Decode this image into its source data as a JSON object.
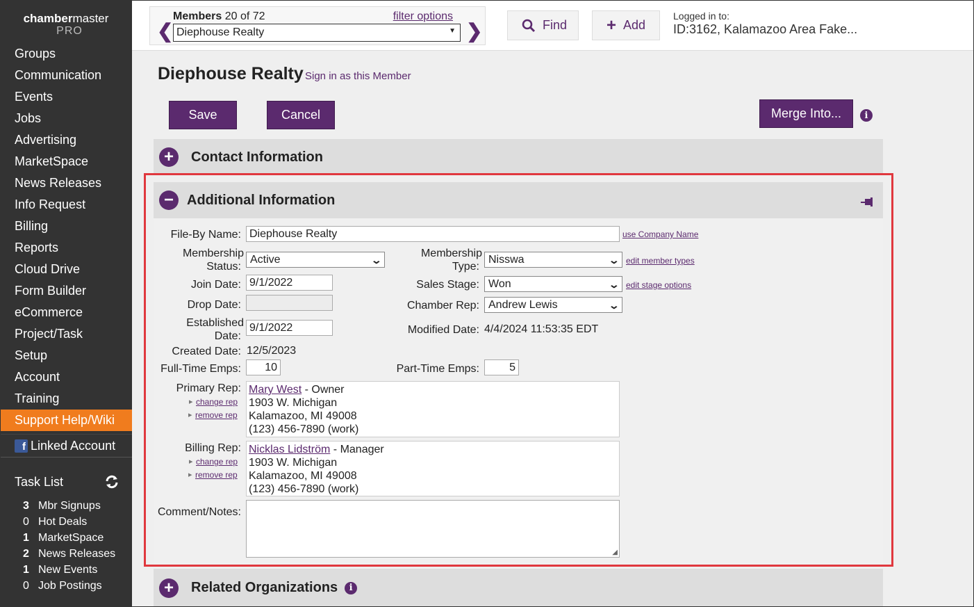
{
  "brand": {
    "line1_bold": "chamber",
    "line1_rest": "master",
    "line2": "PRO"
  },
  "sidebar": {
    "items": [
      "Groups",
      "Communication",
      "Events",
      "Jobs",
      "Advertising",
      "MarketSpace",
      "News Releases",
      "Info Request",
      "Billing",
      "Reports",
      "Cloud Drive",
      "Form Builder",
      "eCommerce",
      "Project/Task",
      "Setup",
      "Account",
      "Training",
      "Support Help/Wiki"
    ],
    "linked_account": "Linked Account",
    "task_list_title": "Task List",
    "tasks": [
      {
        "count": "3",
        "label": "Mbr Signups"
      },
      {
        "count": "0",
        "label": "Hot Deals"
      },
      {
        "count": "1",
        "label": "MarketSpace"
      },
      {
        "count": "2",
        "label": "News Releases"
      },
      {
        "count": "1",
        "label": "New Events"
      },
      {
        "count": "0",
        "label": "Job Postings"
      }
    ]
  },
  "topbar": {
    "members_label": "Members",
    "members_count": "20 of 72",
    "filter_options": "filter options",
    "member_select": "Diephouse Realty",
    "find": "Find",
    "add": "Add",
    "logged_label": "Logged in to:",
    "logged_value": "ID:3162, Kalamazoo Area Fake..."
  },
  "page": {
    "title": "Diephouse Realty",
    "sign_in": "Sign in as this Member",
    "save": "Save",
    "cancel": "Cancel",
    "merge": "Merge Into..."
  },
  "sections": {
    "contact": "Contact Information",
    "additional": "Additional Information",
    "related": "Related Organizations"
  },
  "form": {
    "file_by_label": "File-By Name:",
    "file_by_value": "Diephouse Realty",
    "use_company_name": "use Company Name",
    "membership_status_label1": "Membership",
    "membership_status_label2": "Status:",
    "membership_status_value": "Active",
    "membership_type_label1": "Membership",
    "membership_type_label2": "Type:",
    "membership_type_value": "Nisswa",
    "edit_member_types": "edit member types",
    "join_date_label": "Join Date:",
    "join_date_value": "9/1/2022",
    "sales_stage_label": "Sales Stage:",
    "sales_stage_value": "Won",
    "edit_stage_options": "edit stage options",
    "drop_date_label": "Drop Date:",
    "chamber_rep_label": "Chamber Rep:",
    "chamber_rep_value": "Andrew Lewis",
    "established_label1": "Established",
    "established_label2": "Date:",
    "established_value": "9/1/2022",
    "modified_label": "Modified Date:",
    "modified_value": "4/4/2024 11:53:35 EDT",
    "created_label": "Created Date:",
    "created_value": "12/5/2023",
    "fulltime_label": "Full-Time Emps:",
    "fulltime_value": "10",
    "parttime_label": "Part-Time Emps:",
    "parttime_value": "5",
    "primary_rep_label": "Primary Rep:",
    "primary_rep": {
      "name": "Mary West",
      "role": " - Owner",
      "addr1": "1903 W. Michigan",
      "addr2": "Kalamazoo, MI 49008",
      "phone": "(123) 456-7890 (work)"
    },
    "billing_rep_label": "Billing Rep:",
    "billing_rep": {
      "name": "Nicklas Lidström",
      "role": " - Manager",
      "addr1": "1903 W. Michigan",
      "addr2": "Kalamazoo, MI 49008",
      "phone": "(123) 456-7890 (work)"
    },
    "change_rep": "change rep",
    "remove_rep": "remove rep",
    "comment_label": "Comment/Notes:"
  },
  "colors": {
    "accent": "#5b2a6e",
    "active_nav": "#f07c1e",
    "highlight": "#e0383e",
    "sidebar": "#333333"
  }
}
